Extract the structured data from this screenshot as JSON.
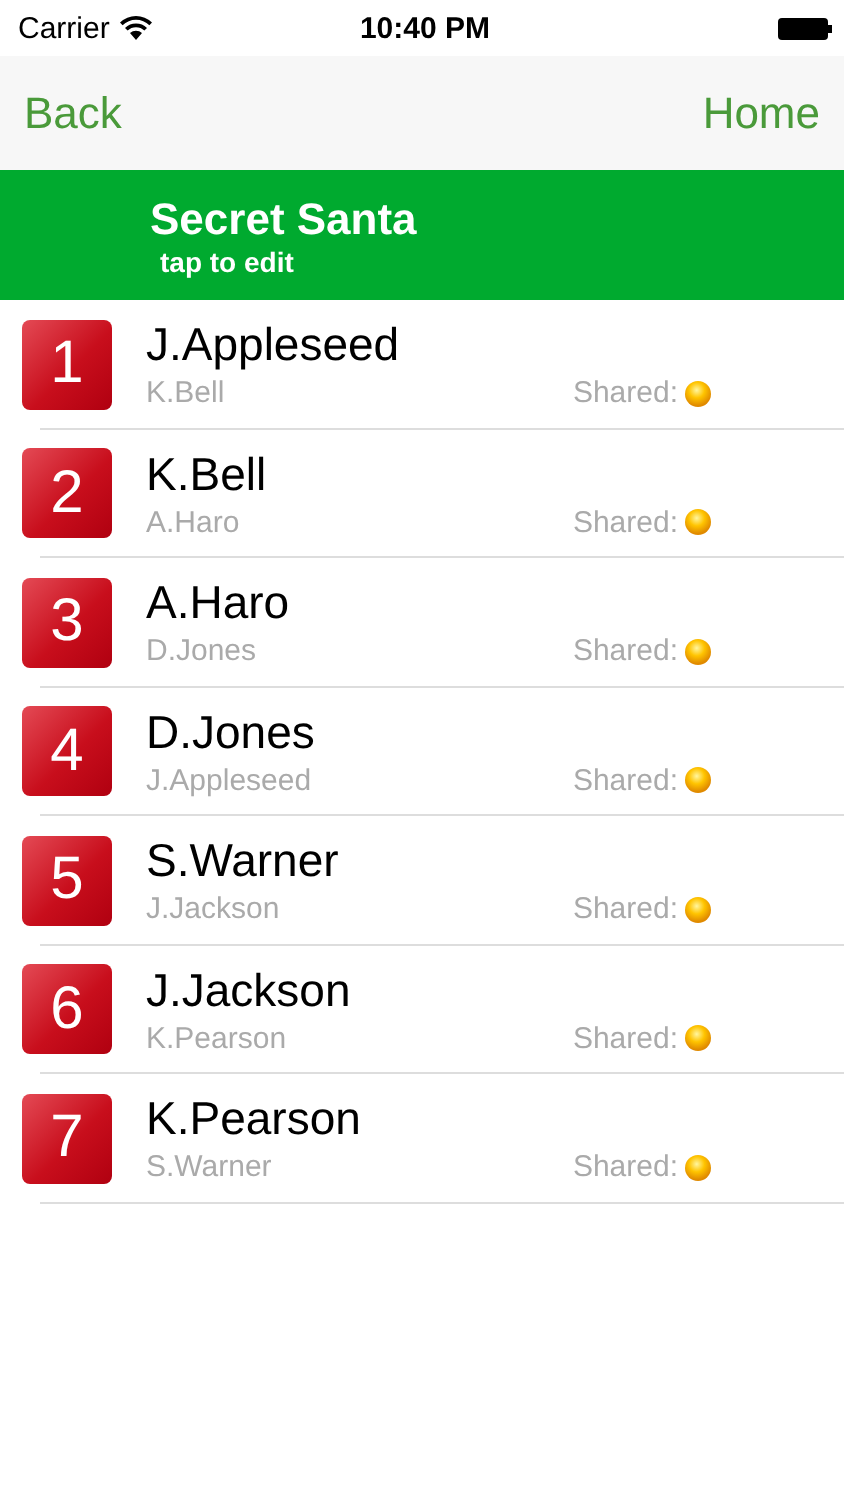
{
  "status_bar": {
    "carrier": "Carrier",
    "time": "10:40 PM"
  },
  "nav": {
    "back": "Back",
    "home": "Home"
  },
  "header": {
    "title": "Secret Santa",
    "subtitle": "tap to edit"
  },
  "rows": [
    {
      "number": "1",
      "name": "J.Appleseed",
      "recipient": "K.Bell",
      "shared_label": "Shared:"
    },
    {
      "number": "2",
      "name": "K.Bell",
      "recipient": "A.Haro",
      "shared_label": "Shared:"
    },
    {
      "number": "3",
      "name": "A.Haro",
      "recipient": "D.Jones",
      "shared_label": "Shared:"
    },
    {
      "number": "4",
      "name": "D.Jones",
      "recipient": "J.Appleseed",
      "shared_label": "Shared:"
    },
    {
      "number": "5",
      "name": "S.Warner",
      "recipient": "J.Jackson",
      "shared_label": "Shared:"
    },
    {
      "number": "6",
      "name": "J.Jackson",
      "recipient": "K.Pearson",
      "shared_label": "Shared:"
    },
    {
      "number": "7",
      "name": "K.Pearson",
      "recipient": "S.Warner",
      "shared_label": "Shared:"
    }
  ]
}
